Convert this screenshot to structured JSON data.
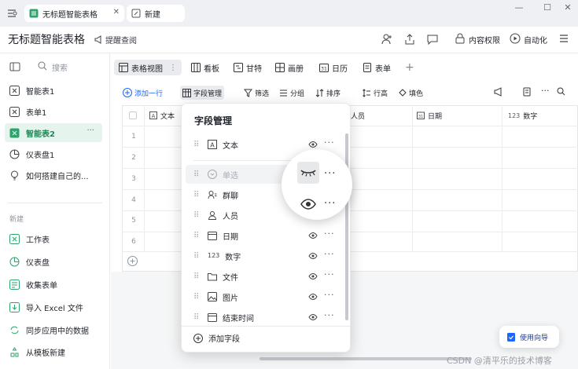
{
  "window": {
    "tabs": [
      {
        "label": "无标题智能表格",
        "active": true
      },
      {
        "label": "新建",
        "active": false
      }
    ],
    "controls": [
      "minimize",
      "maximize",
      "close"
    ]
  },
  "header": {
    "title": "无标题智能表格",
    "reminder": "提醒查阅",
    "permission_label": "内容权限",
    "automation_label": "自动化"
  },
  "sidebar": {
    "search_placeholder": "搜索",
    "items": [
      {
        "label": "智能表1",
        "icon": "smart-table-icon"
      },
      {
        "label": "表单1",
        "icon": "form-icon"
      },
      {
        "label": "智能表2",
        "icon": "smart-table-icon",
        "active": true
      },
      {
        "label": "仪表盘1",
        "icon": "dashboard-icon"
      },
      {
        "label": "如何搭建自己的...",
        "icon": "bulb-icon"
      }
    ],
    "new_section": "新建",
    "new_items": [
      {
        "label": "工作表",
        "icon": "sheet-icon"
      },
      {
        "label": "仪表盘",
        "icon": "dashboard-icon"
      },
      {
        "label": "收集表单",
        "icon": "form-icon"
      },
      {
        "label": "导入 Excel 文件",
        "icon": "import-icon"
      },
      {
        "label": "同步应用中的数据",
        "icon": "sync-icon"
      },
      {
        "label": "从模板新建",
        "icon": "template-icon"
      }
    ]
  },
  "views": {
    "tabs": [
      "表格视图",
      "看板",
      "甘特",
      "画册",
      "日历",
      "表单"
    ],
    "active": "表格视图"
  },
  "toolbar": {
    "add_row": "添加一行",
    "field_manage": "字段管理",
    "filter": "筛选",
    "group": "分组",
    "sort": "排序",
    "row_height": "行高",
    "fill": "填色"
  },
  "grid": {
    "columns": [
      "文本",
      "人员",
      "日期",
      "数字"
    ],
    "rows": [
      "1",
      "2",
      "3",
      "4",
      "5",
      "6"
    ]
  },
  "field_panel": {
    "title": "字段管理",
    "fields": [
      {
        "label": "文本",
        "icon": "text-icon",
        "visible": true
      },
      {
        "label": "单选",
        "icon": "single-select-icon",
        "visible": false
      },
      {
        "label": "群聊",
        "icon": "group-chat-icon",
        "visible": true
      },
      {
        "label": "人员",
        "icon": "person-icon",
        "visible": true
      },
      {
        "label": "日期",
        "icon": "date-icon",
        "visible": true
      },
      {
        "label": "数字",
        "icon": "number-icon",
        "visible": true
      },
      {
        "label": "文件",
        "icon": "folder-icon",
        "visible": true
      },
      {
        "label": "图片",
        "icon": "image-icon",
        "visible": true
      },
      {
        "label": "结束时间",
        "icon": "date-icon",
        "visible": true
      }
    ],
    "number_prefix": "123",
    "add_field": "添加字段"
  },
  "guide_button": "使用向导",
  "watermark": "CSDN @清平乐的技术博客",
  "colors": {
    "accent_green": "#1f8a57",
    "active_bg": "#e6f4ee",
    "primary_blue": "#1a66ff"
  }
}
